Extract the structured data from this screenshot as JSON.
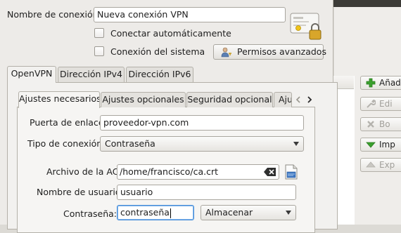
{
  "dialog": {
    "connection_name_label": "Nombre de conexión:",
    "connection_name_value": "Nueva conexión VPN",
    "auto_connect_label": "Conectar automáticamente",
    "system_connection_label": "Conexión del sistema",
    "advanced_permissions_button": "Permisos avanzados",
    "tabs": [
      "OpenVPN",
      "Dirección IPv4",
      "Dirección IPv6"
    ],
    "active_tab": "OpenVPN"
  },
  "openvpn": {
    "subtabs": [
      "Ajustes necesarios",
      "Ajustes opcionales",
      "Seguridad opcional",
      "Aju"
    ],
    "active_subtab": "Ajustes necesarios",
    "gateway_label": "Puerta de enlace:",
    "gateway_value": "proveedor-vpn.com",
    "connection_type_label": "Tipo de conexión:",
    "connection_type_value": "Contraseña",
    "ca_file_label": "Archivo de la AC:",
    "ca_file_value": "/home/francisco/ca.crt",
    "username_label": "Nombre de usuario:",
    "username_value": "usuario",
    "password_label": "Contraseña:",
    "password_value": "contraseña",
    "password_storage_value": "Almacenar"
  },
  "side_panel": {
    "buttons": [
      {
        "label": "Añad",
        "icon": "plus-icon",
        "enabled": true
      },
      {
        "label": "Edi",
        "icon": "wrench-icon",
        "enabled": false
      },
      {
        "label": "Bo",
        "icon": "delete-icon",
        "enabled": false
      },
      {
        "label": "Imp",
        "icon": "import-arrow-icon",
        "enabled": true
      },
      {
        "label": "Exp",
        "icon": "export-arrow-icon",
        "enabled": false
      }
    ]
  },
  "colors": {
    "accent_green": "#3aa02d",
    "dialog_bg": "#edebe8",
    "titlebar_dark": "#3c3b37"
  }
}
